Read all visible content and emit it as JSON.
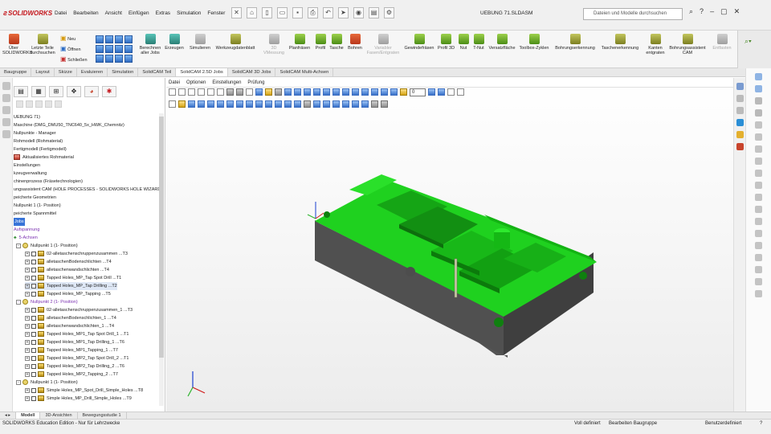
{
  "brand": "SOLIDWORKS",
  "menu": [
    "Datei",
    "Bearbeiten",
    "Ansicht",
    "Einfügen",
    "Extras",
    "Simulation",
    "Fenster"
  ],
  "document_title": "UEBUNG 71.SLDASM",
  "search": {
    "placeholder": "Dateien und Modelle durchsuchen"
  },
  "ribbon": {
    "ueber": "Über\nSOLIDWORKS",
    "letzte_teile": "Letzte Teile\ndurchsuchen",
    "neu": "Neu",
    "oeffnen": "Öffnen",
    "schliessen": "Schließen",
    "berechnen": "Berechnen\naller Jobs",
    "erzeugen": "Erzeugen",
    "simulieren": "Simulieren",
    "werkzeugdatenblatt": "Werkzeugdatenblatt",
    "3d_messung": "3D\nVMessung",
    "planfraesen": "Planfräsen",
    "profil": "Profil",
    "tasche": "Tasche",
    "bohren": "Bohren",
    "variabler_fasen": "Variabler\nFasen/Entgraten",
    "gewindefraesen": "Gewindefräsen",
    "profil_3d": "Profil 3D",
    "nut": "Nut",
    "t_nut": "T-Nut",
    "versatzflaeche": "Versatzfläche",
    "toolbox_zyklen": "Toolbox-Zyklen",
    "bohrungserkennung": "Bohrungserkennung",
    "taschenerkennung": "Taschenerkennung",
    "kanten_entgraten": "Kanten\nentgraten",
    "bohrungsassistent": "Bohrungsassistent\nCAM",
    "entfasten": "Entfasten"
  },
  "tabs": [
    "Baugruppe",
    "Layout",
    "Skizze",
    "Evaluieren",
    "Simulation",
    "SolidCAM Teil",
    "SolidCAM 2.5D Jobs",
    "SolidCAM 3D Jobs",
    "SolidCAM Multi-Achsen"
  ],
  "cam_menu": [
    "Datei",
    "Optionen",
    "Einstellungen",
    "Prüfung"
  ],
  "zoom_value": "0",
  "tree": {
    "root": "UEBUNG 71)",
    "machine": "Maschine (DMG_DMU50_TNC640_5x_HWK_Chemnitz)",
    "nullpunkt_manager": "Nullpunkte - Manager",
    "rohmodell": "Rohmodell (Rohmaterial)",
    "fertigmodell": "Fertigmodell (Fertigmodell)",
    "aktualisiert": "Aktualisiertes Rohmaterial",
    "einstellungen": "Einstellungen",
    "werkzeug": "kzeugverwaltung",
    "maschinen": "chinenprozess (Fräsetechnologien)",
    "assistent": "ungsassistent CAM (HOLE PROCESSES - SOLIDWORKS HOLE WIZARD - MI",
    "geometrien": "peicherte Geometrien",
    "nullpunkt1": "Nullpunkt 1 (1- Position)",
    "spannmittel": "peicherte Spannmittel",
    "jobs": "Jobs",
    "aufspannung": "Aufspannung",
    "achsen": "5-Achsen",
    "group1_title": "Nullpunkt 1 (1- Position)",
    "group1": [
      "02-alletaschenschruppenzusammen ...T3",
      "alletaschenBodenschlichten ...T4",
      "alletaschenwandschlichten ...T4",
      "Tapped Holes_MP_Tap Spot Drill ...T1",
      "Tapped Holes_MP_Tap Drilling ...T2",
      "Tapped Holes_MP_Tapping ...T5"
    ],
    "group2_title": "Nullpunkt 2 (1- Position)",
    "group2": [
      "02-alletaschenschruppenzusammen_1 ...T3",
      "alletaschenBodenschlichten_1 ...T4",
      "alletaschenwandschlichten_1 ...T4",
      "Tapped Holes_MP1_Tap Spot Drill_1 ...T1",
      "Tapped Holes_MP1_Tap Drilling_1 ...T6",
      "Tapped Holes_MP1_Tapping_1 ...T7",
      "Tapped Holes_MP2_Tap Spot Drill_2 ...T1",
      "Tapped Holes_MP2_Tap Drilling_2 ...T6",
      "Tapped Holes_MP2_Tapping_2 ...T7"
    ],
    "group3_title": "Nullpunkt 1 (1- Position)",
    "group3": [
      "Simple Holes_MP_Spot_Drill_Simple_Holes ...T8",
      "Simple Holes_MP_Drill_Simple_Holes ...T9"
    ]
  },
  "bottom_tabs": [
    "Modell",
    "3D-Ansichten",
    "Bewegungsstudie 1"
  ],
  "status": {
    "edition": "SOLIDWORKS Education Edition - Nur für Lehrzwecke",
    "defined": "Voll definiert",
    "editing": "Bearbeiten Baugruppe",
    "units": "Benutzerdefiniert"
  },
  "colors": {
    "model_green": "#1fd11f",
    "model_grey": "#5a5a5a",
    "selection": "#3874d8",
    "brand_red": "#c4161c"
  }
}
